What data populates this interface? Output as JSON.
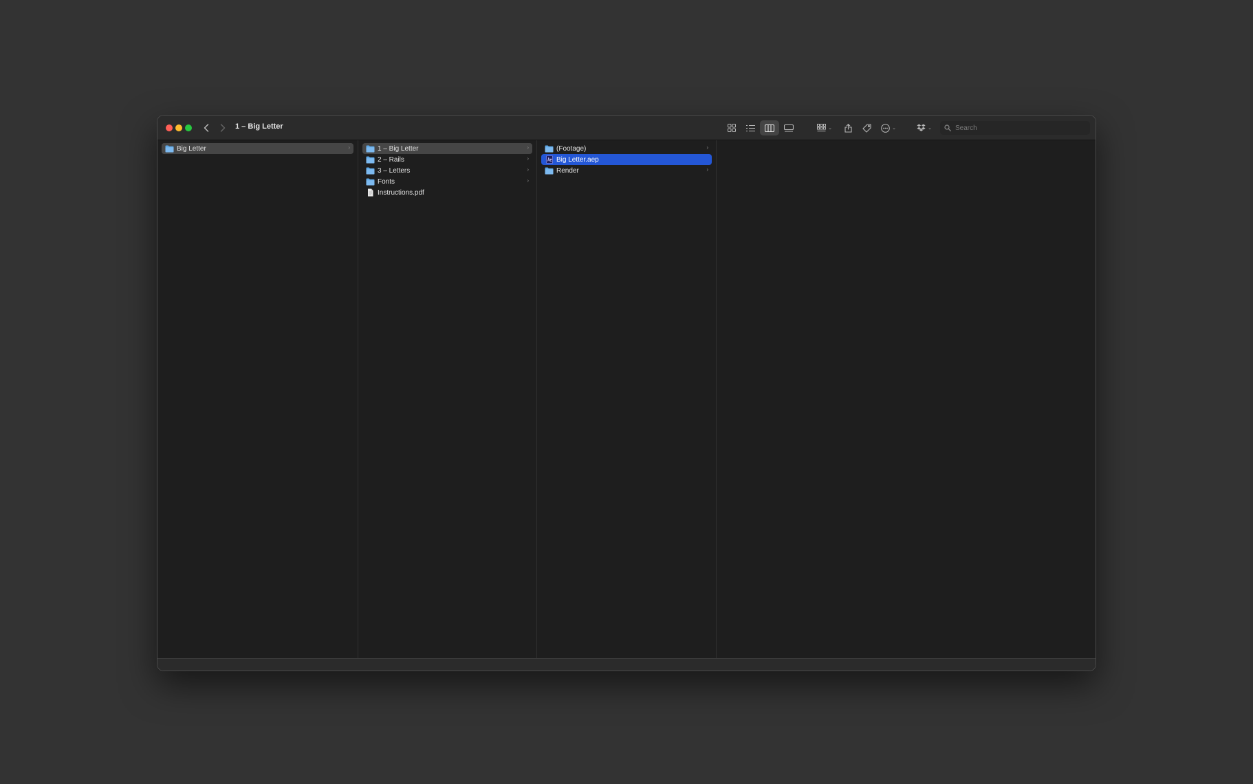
{
  "window": {
    "title": "1 – Big Letter",
    "back_glyph": "‹",
    "forward_glyph": "›"
  },
  "toolbar": {
    "view_icons": "icon-view-icon",
    "view_list": "list-view-icon",
    "view_columns": "column-view-icon",
    "view_gallery": "gallery-view-icon",
    "group": "group-icon",
    "share": "share-icon",
    "tags": "tag-icon",
    "action": "more-icon",
    "dropbox": "dropbox-icon",
    "chevron": "⌄"
  },
  "search": {
    "placeholder": "Search",
    "value": ""
  },
  "columns": [
    {
      "items": [
        {
          "label": "Big Letter",
          "kind": "folder",
          "chevron": "›",
          "state": "selected-inactive"
        }
      ]
    },
    {
      "items": [
        {
          "label": "1 – Big Letter",
          "kind": "folder",
          "chevron": "›",
          "state": "selected-inactive"
        },
        {
          "label": "2 – Rails",
          "kind": "folder",
          "chevron": "›",
          "state": "normal"
        },
        {
          "label": "3 – Letters",
          "kind": "folder",
          "chevron": "›",
          "state": "normal"
        },
        {
          "label": "Fonts",
          "kind": "folder",
          "chevron": "›",
          "state": "normal"
        },
        {
          "label": "Instructions.pdf",
          "kind": "file",
          "chevron": "",
          "state": "normal"
        }
      ]
    },
    {
      "items": [
        {
          "label": "(Footage)",
          "kind": "folder",
          "chevron": "›",
          "state": "normal"
        },
        {
          "label": "Big Letter.aep",
          "kind": "aep",
          "chevron": "",
          "state": "selected-active"
        },
        {
          "label": "Render",
          "kind": "folder",
          "chevron": "›",
          "state": "normal"
        }
      ]
    }
  ],
  "colors": {
    "accent": "#2457d6",
    "folder": "#5fa8e6",
    "close": "#ff5f57",
    "minimize": "#febc2e",
    "maximize": "#28c840"
  }
}
